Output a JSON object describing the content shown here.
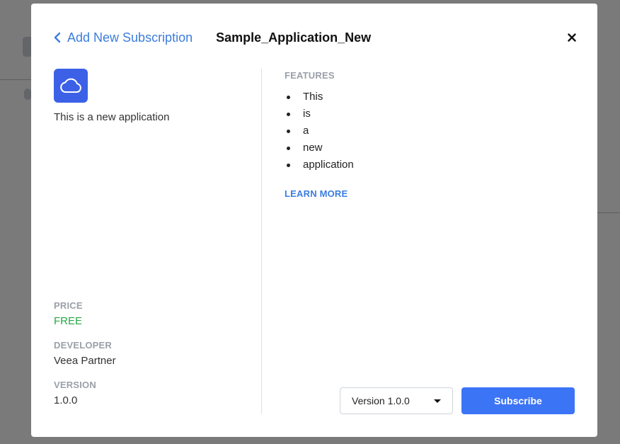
{
  "header": {
    "back_label": "Add New Subscription",
    "app_name": "Sample_Application_New"
  },
  "app": {
    "description": "This is a new application"
  },
  "meta": {
    "price_label": "PRICE",
    "price_value": "FREE",
    "developer_label": "DEVELOPER",
    "developer_value": "Veea Partner",
    "version_label": "VERSION",
    "version_value": "1.0.0"
  },
  "features": {
    "label": "FEATURES",
    "items": [
      "This",
      "is",
      "a",
      "new",
      "application"
    ],
    "learn_more": "LEARN MORE"
  },
  "footer": {
    "version_select": "Version 1.0.0",
    "subscribe_label": "Subscribe"
  },
  "colors": {
    "accent": "#3b7ddd",
    "primary_button": "#3c74f6",
    "app_icon": "#3c61e6",
    "price": "#28a745",
    "label_gray": "#9aa0a9"
  },
  "icons": {
    "back": "chevron-left-icon",
    "close": "close-icon",
    "app": "cloud-icon",
    "select": "caret-down-icon"
  }
}
